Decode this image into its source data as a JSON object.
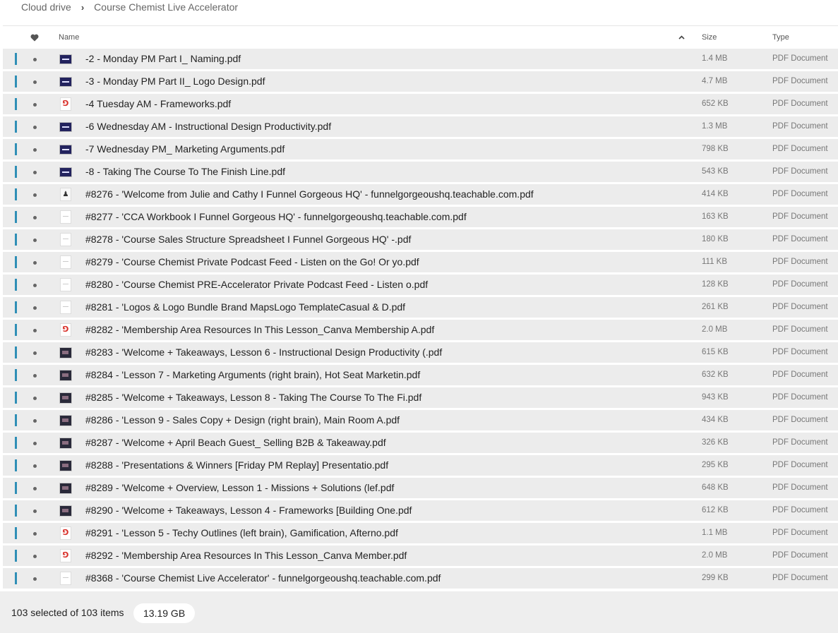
{
  "breadcrumb": {
    "root": "Cloud drive",
    "separator": "›",
    "current": "Course Chemist Live Accelerator"
  },
  "header": {
    "name": "Name",
    "size": "Size",
    "type": "Type",
    "fav_icon": "heart-icon",
    "sort_icon": "chevron-up-icon"
  },
  "colors": {
    "selection_bar": "#2f8fb6",
    "row_bg": "#ececec",
    "pdf_red": "#d9312b"
  },
  "files": [
    {
      "name": "-2 - Monday PM Part I_ Naming.pdf",
      "size": "1.4 MB",
      "type": "PDF Document",
      "thumb": "slide"
    },
    {
      "name": "-3 - Monday PM Part II_ Logo Design.pdf",
      "size": "4.7 MB",
      "type": "PDF Document",
      "thumb": "slide"
    },
    {
      "name": "-4 Tuesday AM - Frameworks.pdf",
      "size": "652 KB",
      "type": "PDF Document",
      "thumb": "pdf"
    },
    {
      "name": "-6 Wednesday AM - Instructional Design Productivity.pdf",
      "size": "1.3 MB",
      "type": "PDF Document",
      "thumb": "slide"
    },
    {
      "name": "-7 Wednesday PM_ Marketing Arguments.pdf",
      "size": "798 KB",
      "type": "PDF Document",
      "thumb": "slide"
    },
    {
      "name": "-8 - Taking The Course To The Finish Line.pdf",
      "size": "543 KB",
      "type": "PDF Document",
      "thumb": "slide"
    },
    {
      "name": "#8276 - 'Welcome from Julie and Cathy I Funnel Gorgeous HQ' - funnelgorgeoushq.teachable.com.pdf",
      "size": "414 KB",
      "type": "PDF Document",
      "thumb": "people"
    },
    {
      "name": "#8277 - 'CCA Workbook I Funnel Gorgeous HQ' - funnelgorgeoushq.teachable.com.pdf",
      "size": "163 KB",
      "type": "PDF Document",
      "thumb": "page"
    },
    {
      "name": "#8278 - 'Course Sales Structure Spreadsheet I Funnel Gorgeous HQ' -.pdf",
      "size": "180 KB",
      "type": "PDF Document",
      "thumb": "page"
    },
    {
      "name": "#8279 - 'Course Chemist Private Podcast Feed - Listen on the Go! Or yo.pdf",
      "size": "111 KB",
      "type": "PDF Document",
      "thumb": "page"
    },
    {
      "name": "#8280 - 'Course Chemist PRE-Accelerator Private Podcast Feed - Listen o.pdf",
      "size": "128 KB",
      "type": "PDF Document",
      "thumb": "page"
    },
    {
      "name": "#8281 - 'Logos & Logo Bundle Brand MapsLogo TemplateCasual & D.pdf",
      "size": "261 KB",
      "type": "PDF Document",
      "thumb": "page"
    },
    {
      "name": "#8282 - 'Membership Area Resources In This Lesson_Canva Membership A.pdf",
      "size": "2.0 MB",
      "type": "PDF Document",
      "thumb": "pdf"
    },
    {
      "name": "#8283 - 'Welcome + Takeaways, Lesson 6 - Instructional Design Productivity (.pdf",
      "size": "615 KB",
      "type": "PDF Document",
      "thumb": "photo"
    },
    {
      "name": "#8284 - 'Lesson 7 - Marketing Arguments (right brain), Hot Seat Marketin.pdf",
      "size": "632 KB",
      "type": "PDF Document",
      "thumb": "photo"
    },
    {
      "name": "#8285 - 'Welcome + Takeaways, Lesson 8 - Taking The Course To The Fi.pdf",
      "size": "943 KB",
      "type": "PDF Document",
      "thumb": "photo"
    },
    {
      "name": "#8286 - 'Lesson 9 - Sales Copy + Design (right brain), Main Room A.pdf",
      "size": "434 KB",
      "type": "PDF Document",
      "thumb": "photo"
    },
    {
      "name": "#8287 - 'Welcome + April Beach Guest_ Selling B2B & Takeaway.pdf",
      "size": "326 KB",
      "type": "PDF Document",
      "thumb": "photo"
    },
    {
      "name": "#8288 - 'Presentations & Winners [Friday PM Replay] Presentatio.pdf",
      "size": "295 KB",
      "type": "PDF Document",
      "thumb": "photo"
    },
    {
      "name": "#8289 - 'Welcome + Overview, Lesson 1 - Missions + Solutions (lef.pdf",
      "size": "648 KB",
      "type": "PDF Document",
      "thumb": "photo"
    },
    {
      "name": "#8290 - 'Welcome + Takeaways, Lesson 4 - Frameworks [Building One.pdf",
      "size": "612 KB",
      "type": "PDF Document",
      "thumb": "photo"
    },
    {
      "name": "#8291 - 'Lesson 5 - Techy Outlines (left brain), Gamification, Afterno.pdf",
      "size": "1.1 MB",
      "type": "PDF Document",
      "thumb": "pdf"
    },
    {
      "name": "#8292 - 'Membership Area Resources In This Lesson_Canva Member.pdf",
      "size": "2.0 MB",
      "type": "PDF Document",
      "thumb": "pdf"
    },
    {
      "name": "#8368 - 'Course Chemist Live Accelerator' - funnelgorgeoushq.teachable.com.pdf",
      "size": "299 KB",
      "type": "PDF Document",
      "thumb": "page"
    }
  ],
  "footer": {
    "selected": "103 selected of 103 items",
    "total_size": "13.19 GB"
  }
}
